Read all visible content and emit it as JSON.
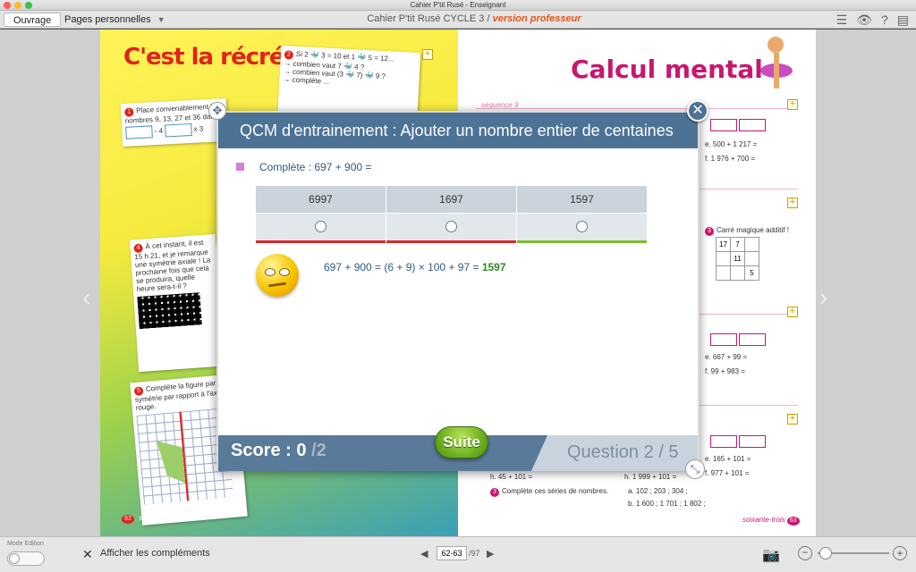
{
  "window": {
    "title": "Cahier P'tit Rusé - Enseignant"
  },
  "toolbar": {
    "tab_ouvrage": "Ouvrage",
    "tab_pages": "Pages personnelles",
    "book_title": "Cahier P'tit Rusé CYCLE 3 /",
    "book_version": "version professeur",
    "icons": [
      "list-icon",
      "eye-icon",
      "help-icon",
      "sidebar-icon"
    ]
  },
  "left_page": {
    "title": "C'est la récré !",
    "ex1": "Place convenablement les nombres 9, 13, 27 et 36 dans",
    "ex1_op": "- 4",
    "ex1_op2": "x 3",
    "ex2_l1": "Si 2 🐳 3 = 10 et 1 🐳 5 = 12...",
    "ex2_l2": "→ combien vaut 7 🐳 4 ?",
    "ex2_l3": "→ combien vaut (3 🐳 7) 🐳 9 ?",
    "ex2_l4": "→ complète ...",
    "ex4": "À cet instant, il est 15 h 21, et je remarque une symétrie axiale ! La prochaine fois que cela se produira, quelle heure sera-t-il ?",
    "ex5": "Complète la figure par symétrie par rapport à l'axe rouge.",
    "page_number": "62",
    "page_word": "soixante-deux"
  },
  "right_page": {
    "title": "Calcul mental",
    "sequence": "séquence 9",
    "r1": "e. 500 + 1 217 =",
    "r2": "f. 1 976 + 700 =",
    "r3": "Carré magique additif !",
    "magic": [
      "17",
      "7",
      "",
      "",
      "11",
      "",
      "",
      "",
      "5"
    ],
    "r4": "e. 667 + 99 =",
    "r5": "f. 99 + 983 =",
    "r6": "e. 165 + 101 =",
    "r7": "f. 977 + 101 =",
    "r8": "h. 45 + 101 =",
    "r9": "h. 1 999 + 101 =",
    "r10": "Complète ces séries de nombres.",
    "r11": "a. 102 ; 203 ; 304 ;",
    "r12": "b. 1 600 ; 1 701 ; 1 802 ;",
    "page_number": "63",
    "page_word": "soixante-trois"
  },
  "modal": {
    "title": "QCM d'entrainement : Ajouter un nombre entier de centaines",
    "question": "Complète : 697 + 900 =",
    "answers": [
      {
        "label": "6997",
        "status_color": "#d8262c"
      },
      {
        "label": "1697",
        "status_color": "#d8262c"
      },
      {
        "label": "1597",
        "status_color": "#7fba2e"
      }
    ],
    "explanation": "697 + 900 = (6 + 9) × 100 + 97 =",
    "explanation_result": "1597",
    "score_label": "Score : 0",
    "score_total": "/2",
    "suite_label": "Suite",
    "question_label": "Question",
    "question_current": "2",
    "question_total": "/ 5"
  },
  "footer": {
    "mode_label": "Mode Edition",
    "complements_label": "Afficher les compléments",
    "page_range": "62-63",
    "page_total": "/97"
  }
}
